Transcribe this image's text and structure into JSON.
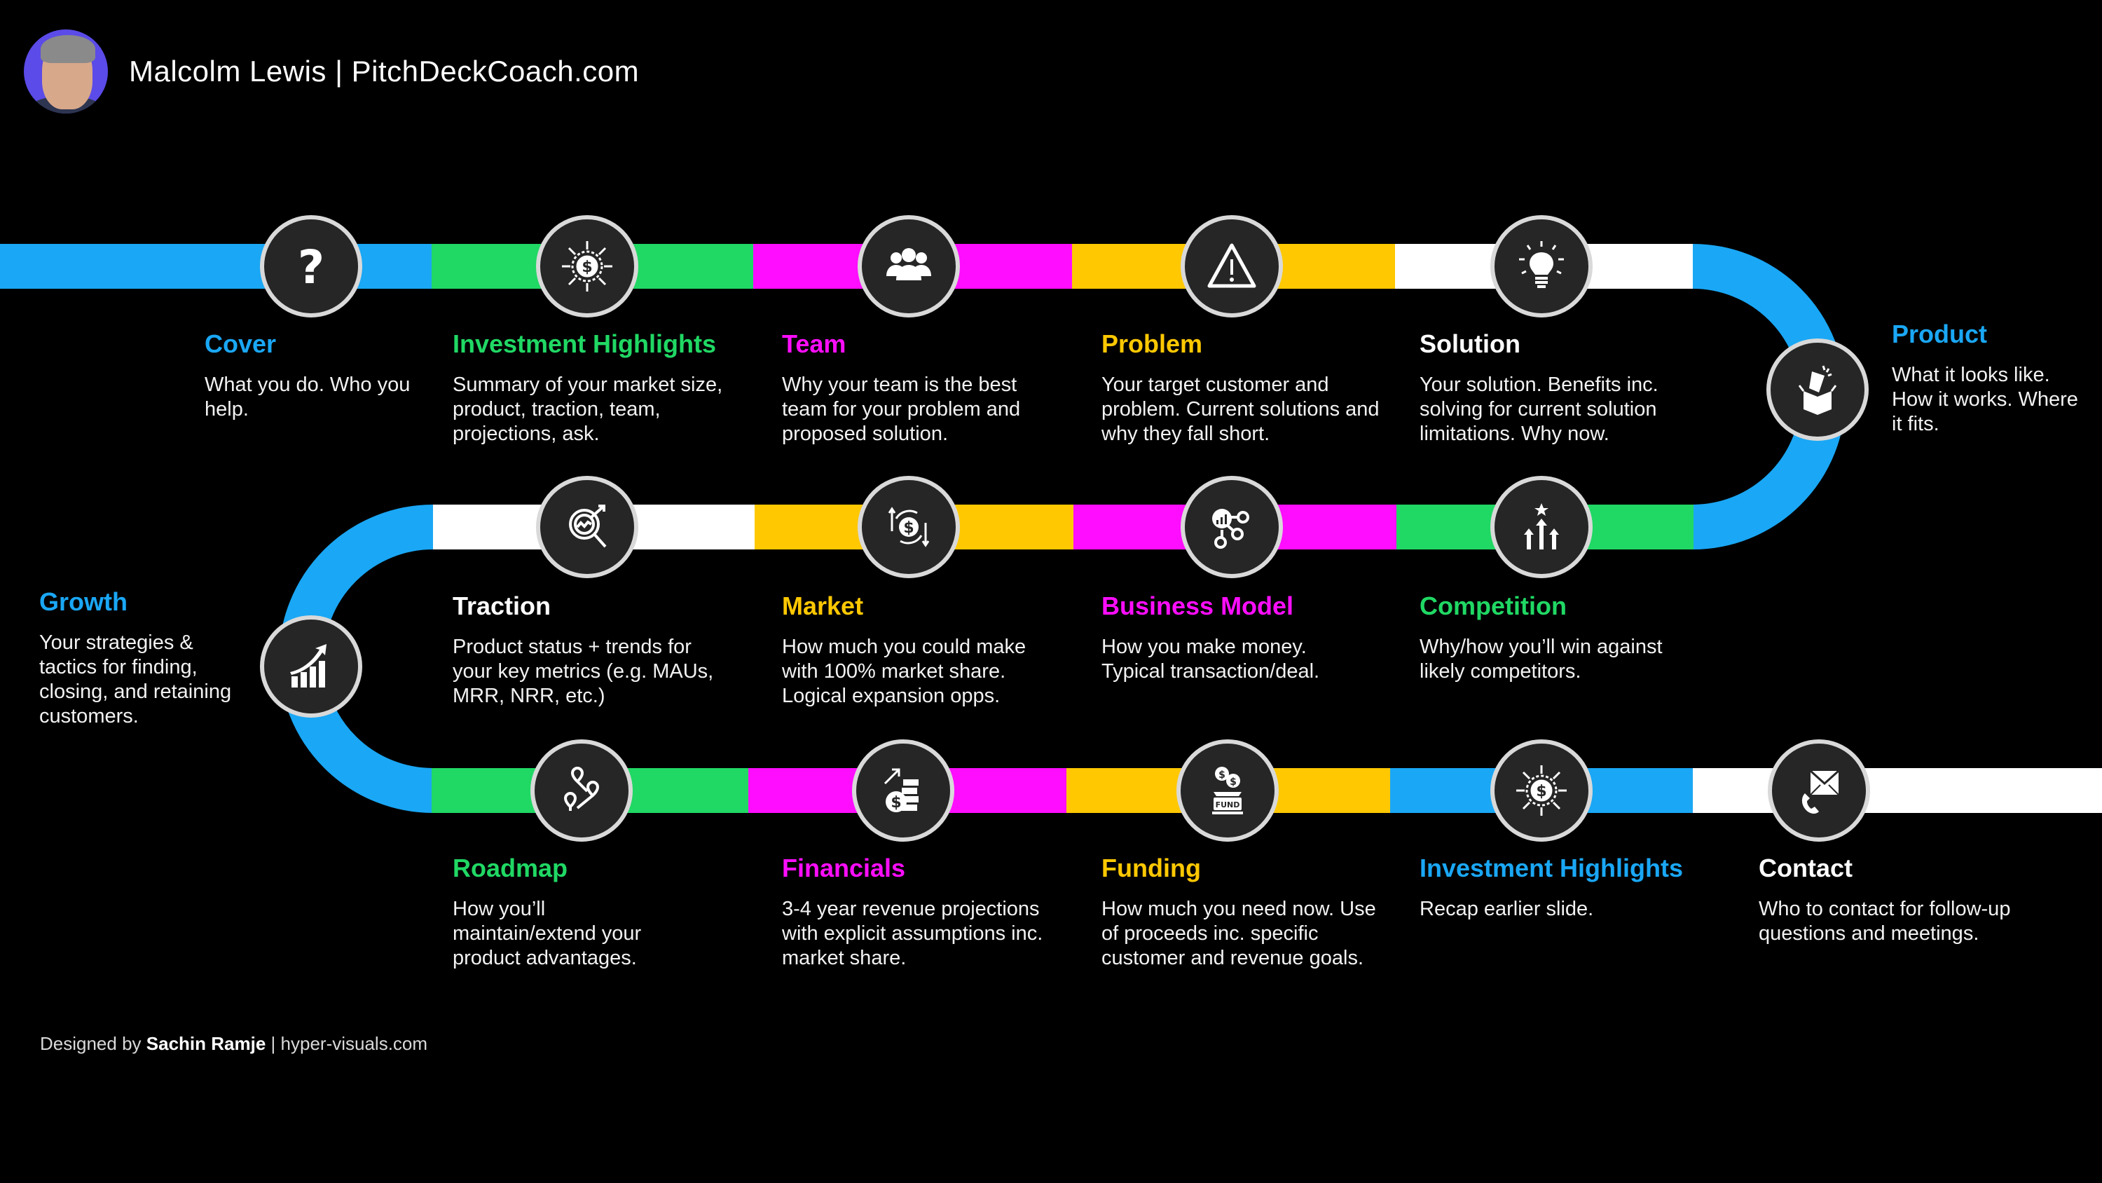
{
  "header": {
    "avatar_alt": "Malcolm Lewis photo",
    "title": "Malcolm Lewis | PitchDeckCoach.com"
  },
  "colors": {
    "blue": "#1aa7f5",
    "green": "#20d864",
    "magenta": "#ff0dff",
    "yellow": "#ffc800",
    "white": "#ffffff",
    "node_fill": "#262626",
    "node_ring": "#d9d9d9"
  },
  "steps": [
    {
      "title": "Cover",
      "color": "#1aa7f5",
      "icon": "question-icon",
      "desc": "What you do. Who you help."
    },
    {
      "title": "Investment Highlights",
      "color": "#20d864",
      "icon": "dollar-burst-icon",
      "desc": "Summary of your market size, product, traction, team, projections, ask."
    },
    {
      "title": "Team",
      "color": "#ff0dff",
      "icon": "team-icon",
      "desc": "Why your team is the best team for your problem and proposed solution."
    },
    {
      "title": "Problem",
      "color": "#ffc800",
      "icon": "warning-icon",
      "desc": "Your target customer and problem. Current solutions and why they fall short."
    },
    {
      "title": "Solution",
      "color": "#ffffff",
      "icon": "lightbulb-icon",
      "desc": "Your solution. Benefits inc. solving for current solution limitations. Why now."
    },
    {
      "title": "Product",
      "color": "#1aa7f5",
      "icon": "product-box-icon",
      "desc": "What it looks like. How it works. Where it fits."
    },
    {
      "title": "Competition",
      "color": "#20d864",
      "icon": "competition-arrows-icon",
      "desc": "Why/how you’ll win against likely competitors."
    },
    {
      "title": "Business Model",
      "color": "#ff0dff",
      "icon": "business-model-icon",
      "desc": "How you make money. Typical transaction/deal."
    },
    {
      "title": "Market",
      "color": "#ffc800",
      "icon": "market-dollar-icon",
      "desc": "How much you could make with 100% market share. Logical expansion opps."
    },
    {
      "title": "Traction",
      "color": "#ffffff",
      "icon": "traction-analytics-icon",
      "desc": "Product status + trends for your key metrics (e.g. MAUs, MRR, NRR, etc.)"
    },
    {
      "title": "Growth",
      "color": "#1aa7f5",
      "icon": "growth-chart-icon",
      "desc": "Your strategies & tactics for finding, closing, and retaining customers."
    },
    {
      "title": "Roadmap",
      "color": "#20d864",
      "icon": "roadmap-pins-icon",
      "desc": "How you’ll maintain/extend your product advantages."
    },
    {
      "title": "Financials",
      "color": "#ff0dff",
      "icon": "financials-coins-icon",
      "desc": "3-4 year revenue projections with explicit assumptions inc. market share."
    },
    {
      "title": "Funding",
      "color": "#ffc800",
      "icon": "fund-icon",
      "desc": "How much you need now. Use of proceeds inc. specific customer and revenue goals."
    },
    {
      "title": "Investment Highlights",
      "color": "#1aa7f5",
      "icon": "dollar-burst-icon",
      "desc": "Recap earlier slide."
    },
    {
      "title": "Contact",
      "color": "#ffffff",
      "icon": "contact-mail-phone-icon",
      "desc": "Who to contact for follow-up questions and meetings."
    }
  ],
  "footer": {
    "prefix": "Designed by",
    "designer": "Sachin Ramje",
    "separator": "|",
    "site": "hyper-visuals.com"
  }
}
